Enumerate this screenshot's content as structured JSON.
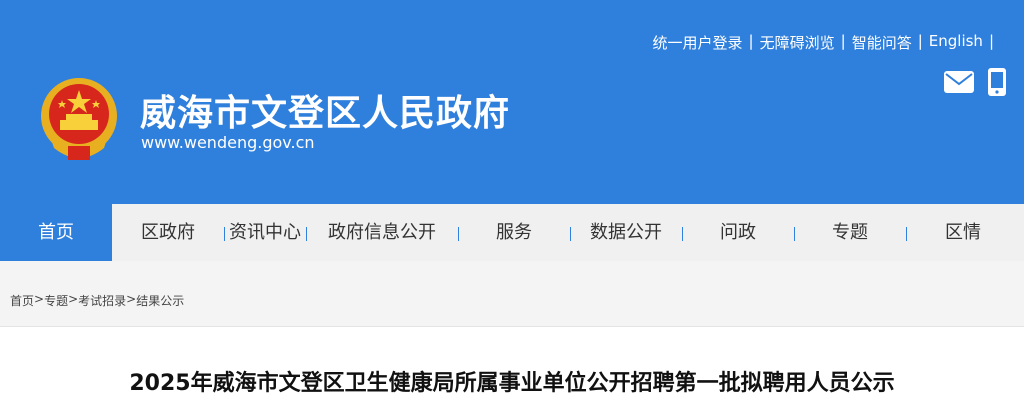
{
  "header": {
    "site_title": "威海市文登区人民政府",
    "site_url": "www.wendeng.gov.cn",
    "top_links": [
      {
        "label": "统一用户登录"
      },
      {
        "label": "无障碍浏览"
      },
      {
        "label": "智能问答"
      },
      {
        "label": "English"
      }
    ],
    "separator": "|",
    "icons": [
      "mail-icon",
      "mobile-icon"
    ],
    "brand_color": "#2f7fdc"
  },
  "nav": {
    "items": [
      {
        "label": "首页",
        "active": true
      },
      {
        "label": "区政府"
      },
      {
        "label": "资讯中心"
      },
      {
        "label": "政府信息公开"
      },
      {
        "label": "服务"
      },
      {
        "label": "数据公开"
      },
      {
        "label": "问政"
      },
      {
        "label": "专题"
      },
      {
        "label": "区情"
      }
    ]
  },
  "breadcrumb": {
    "items": [
      "首页",
      "专题",
      "考试招录",
      "结果公示"
    ],
    "separator": ">"
  },
  "article": {
    "title": "2025年威海市文登区卫生健康局所属事业单位公开招聘第一批拟聘用人员公示"
  }
}
